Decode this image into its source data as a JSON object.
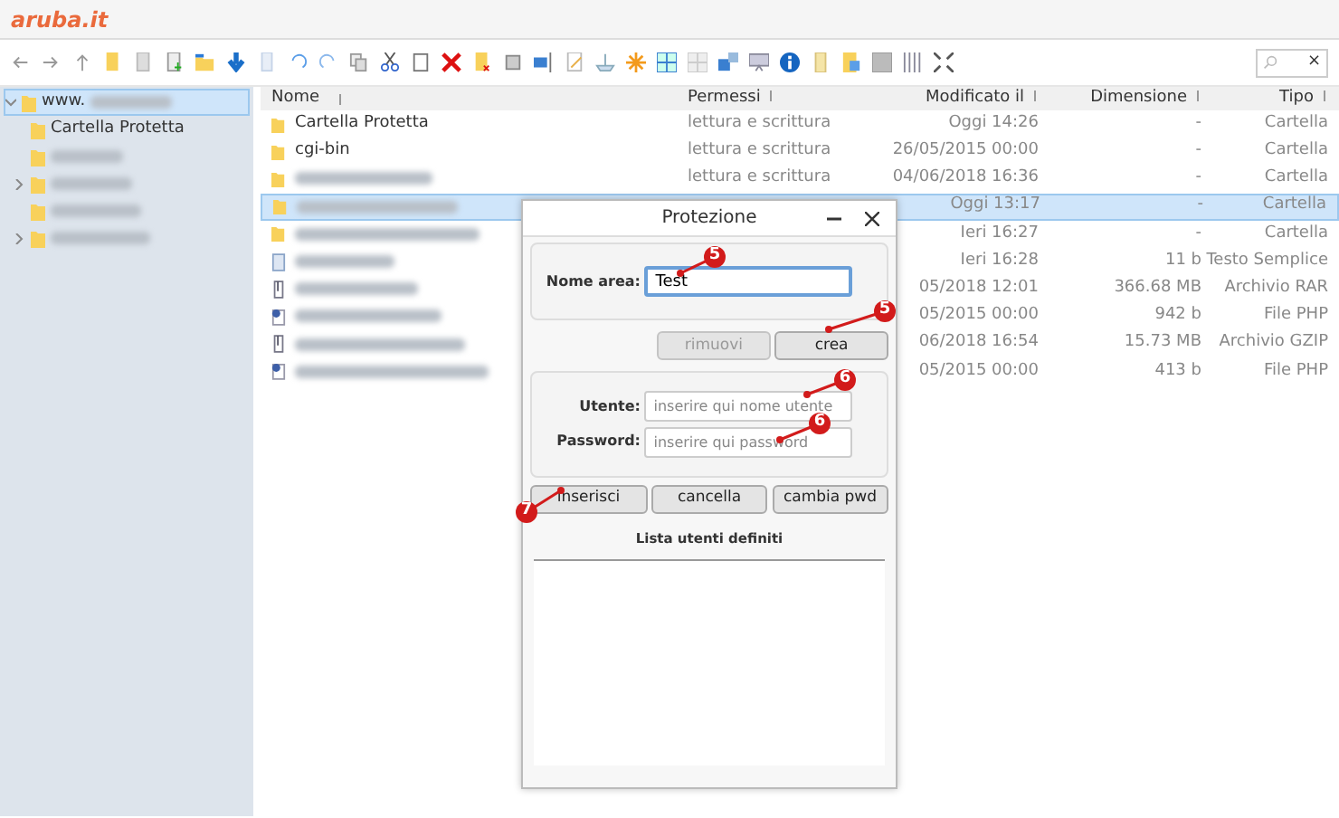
{
  "logo": "aruba.it",
  "search": {
    "clear": "×"
  },
  "tree": {
    "label": "www.",
    "blurred": true,
    "expanded": true,
    "selected": true,
    "children": [
      {
        "label": "Cartella Protetta",
        "blurred": false,
        "has_children": false
      },
      {
        "blurred": true,
        "has_children": false
      },
      {
        "blurred": true,
        "has_children": true
      },
      {
        "blurred": true,
        "has_children": false
      },
      {
        "blurred": true,
        "has_children": true
      }
    ]
  },
  "table": {
    "columns": [
      "Nome",
      "Permessi",
      "Modificato il",
      "Dimensione",
      "Tipo"
    ],
    "rows": [
      {
        "kind": "folder",
        "name": "Cartella Protetta",
        "permissions": "lettura e scrittura",
        "modified": "Oggi 14:26",
        "size": "-",
        "type": "Cartella",
        "selected": false
      },
      {
        "kind": "folder",
        "name": "cgi-bin",
        "permissions": "lettura e scrittura",
        "modified": "26/05/2015 00:00",
        "size": "-",
        "type": "Cartella",
        "selected": false
      },
      {
        "kind": "folder",
        "permissions": "lettura e scrittura",
        "modified": "04/06/2018 16:36",
        "size": "-",
        "type": "Cartella",
        "selected": false
      },
      {
        "kind": "folder",
        "modified": "Oggi 13:17",
        "size": "-",
        "type": "Cartella",
        "selected": true
      },
      {
        "kind": "folder",
        "modified": "Ieri 16:27",
        "size": "-",
        "type": "Cartella",
        "selected": false
      },
      {
        "kind": "text",
        "modified": "Ieri 16:28",
        "size": "11 b",
        "type": "Testo Semplice",
        "selected": false
      },
      {
        "kind": "archive",
        "modified": "05/2018 12:01",
        "size": "366.68 MB",
        "type": "Archivio RAR",
        "selected": false
      },
      {
        "kind": "php",
        "modified": "05/2015 00:00",
        "size": "942 b",
        "type": "File PHP",
        "selected": false
      },
      {
        "kind": "archive",
        "modified": "06/2018 16:54",
        "size": "15.73 MB",
        "type": "Archivio GZIP",
        "selected": false
      },
      {
        "kind": "php",
        "modified": "05/2015 00:00",
        "size": "413 b",
        "type": "File PHP",
        "selected": false
      }
    ]
  },
  "dialog": {
    "title": "Protezione",
    "area_label": "Nome area:",
    "area_value": "Test",
    "buttons_top": [
      {
        "label": "rimuovi",
        "disabled": true
      },
      {
        "label": "crea",
        "disabled": false
      }
    ],
    "user_label": "Utente:",
    "user_placeholder": "inserire qui nome utente",
    "password_label": "Password:",
    "password_placeholder": "inserire qui password",
    "buttons_bottom": [
      {
        "label": "inserisci",
        "disabled": false
      },
      {
        "label": "cancella",
        "disabled": false
      },
      {
        "label": "cambia pwd",
        "disabled": false
      }
    ],
    "list_title": "Lista utenti definiti"
  },
  "annotations": [
    {
      "label": "5"
    },
    {
      "label": "5"
    },
    {
      "label": "6"
    },
    {
      "label": "6"
    },
    {
      "label": "7"
    }
  ]
}
